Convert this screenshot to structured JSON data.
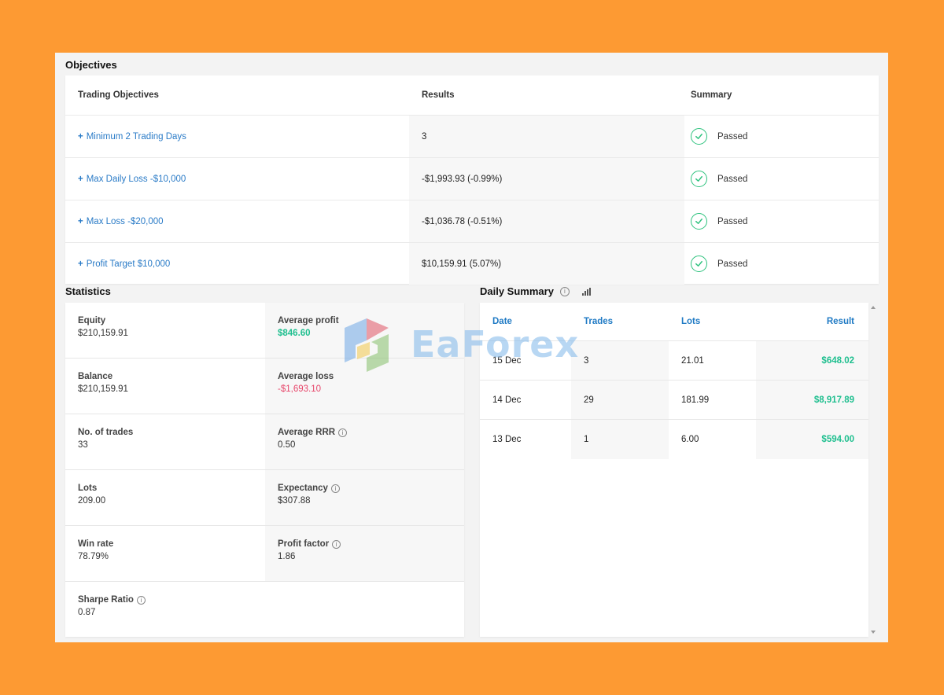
{
  "objectives": {
    "title": "Objectives",
    "headers": {
      "objective": "Trading Objectives",
      "results": "Results",
      "summary": "Summary"
    },
    "rows": [
      {
        "objective": "Minimum 2 Trading Days",
        "result": "3",
        "summary": "Passed"
      },
      {
        "objective": "Max Daily Loss -$10,000",
        "result": "-$1,993.93 (-0.99%)",
        "summary": "Passed"
      },
      {
        "objective": "Max Loss -$20,000",
        "result": "-$1,036.78 (-0.51%)",
        "summary": "Passed"
      },
      {
        "objective": "Profit Target $10,000",
        "result": "$10,159.91 (5.07%)",
        "summary": "Passed"
      }
    ],
    "plus_symbol": "+",
    "link_color": "#2a7bc7",
    "pass_color": "#2ec27e"
  },
  "statistics": {
    "title": "Statistics",
    "left": [
      {
        "label": "Equity",
        "value": "$210,159.91"
      },
      {
        "label": "Balance",
        "value": "$210,159.91"
      },
      {
        "label": "No. of trades",
        "value": "33"
      },
      {
        "label": "Lots",
        "value": "209.00"
      },
      {
        "label": "Win rate",
        "value": "78.79%"
      },
      {
        "label": "Sharpe Ratio",
        "value": "0.87"
      }
    ],
    "right": [
      {
        "label": "Average profit",
        "value": "$846.60"
      },
      {
        "label": "Average loss",
        "value": "-$1,693.10"
      },
      {
        "label": "Average RRR",
        "value": "0.50"
      },
      {
        "label": "Expectancy",
        "value": "$307.88"
      },
      {
        "label": "Profit factor",
        "value": "1.86"
      }
    ],
    "positive_color": "#1fbf8f",
    "negative_color": "#e7456a"
  },
  "daily_summary": {
    "title": "Daily Summary",
    "headers": {
      "date": "Date",
      "trades": "Trades",
      "lots": "Lots",
      "result": "Result"
    },
    "rows": [
      {
        "date": "15 Dec",
        "trades": "3",
        "lots": "21.01",
        "result": "$648.02"
      },
      {
        "date": "14 Dec",
        "trades": "29",
        "lots": "181.99",
        "result": "$8,917.89"
      },
      {
        "date": "13 Dec",
        "trades": "1",
        "lots": "6.00",
        "result": "$594.00"
      }
    ],
    "header_color": "#1f7ac4"
  },
  "watermark": {
    "text": "EaForex"
  },
  "icons": {
    "info": "info-icon",
    "check": "check-circle-icon",
    "chart": "bar-chart-icon"
  }
}
